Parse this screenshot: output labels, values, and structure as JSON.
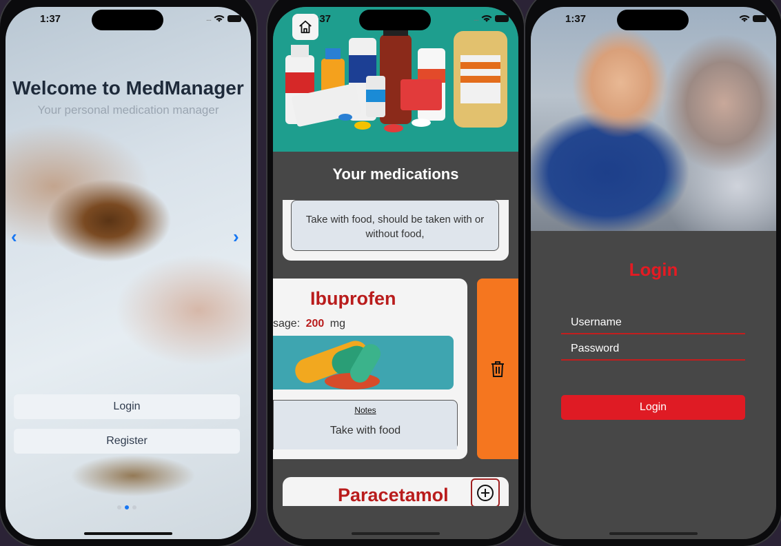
{
  "status": {
    "time": "1:37",
    "signal_dots": "...."
  },
  "welcome_screen": {
    "title": "Welcome to MedManager",
    "subtitle": "Your personal medication manager",
    "prev_arrow": "‹",
    "next_arrow": "›",
    "login_label": "Login",
    "register_label": "Register",
    "pager": {
      "pages": 3,
      "active": 2
    }
  },
  "medications_screen": {
    "title": "Your medications",
    "card_top": {
      "notes": "Take with food, should be taken with or without food,"
    },
    "card_ibuprofen": {
      "name": "Ibuprofen",
      "dosage_label": "sage:",
      "dosage_value": "200",
      "dosage_unit": "mg",
      "notes_label": "Notes",
      "notes": "Take with food"
    },
    "card_paracetamol": {
      "name": "Paracetamol"
    },
    "icons": {
      "home": "home-icon",
      "delete": "trash-icon",
      "add": "plus-circle-icon"
    }
  },
  "login_screen": {
    "title": "Login",
    "username_placeholder": "Username",
    "password_placeholder": "Password",
    "login_button": "Login"
  },
  "colors": {
    "accent_red": "#e41b23",
    "delete_orange": "#f5761f",
    "banner_teal": "#1e9e8e",
    "link_blue": "#1877f2"
  }
}
